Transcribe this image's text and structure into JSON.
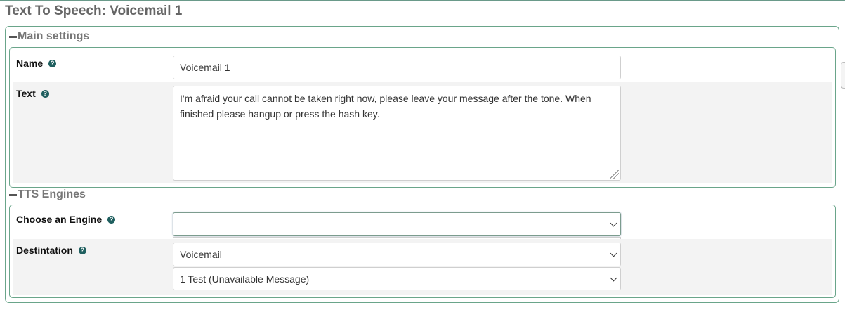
{
  "page": {
    "title": "Text To Speech: Voicemail 1"
  },
  "main_settings": {
    "legend": "Main settings",
    "name": {
      "label": "Name",
      "value": "Voicemail 1"
    },
    "text": {
      "label": "Text",
      "value": "I'm afraid your call cannot be taken right now, please leave your message after the tone. When finished please hangup or press the hash key."
    }
  },
  "tts_engines": {
    "legend": "TTS Engines",
    "engine": {
      "label": "Choose an Engine",
      "value": ""
    },
    "destination": {
      "label": "Destintation",
      "type_value": "Voicemail",
      "target_value": "1 Test (Unavailable Message)"
    }
  },
  "icons": {
    "help": "question-circle-icon",
    "collapse": "minus-icon"
  },
  "colors": {
    "border": "#6aa58a",
    "help_icon": "#1f5f5f",
    "row_alt": "#f3f3f3"
  }
}
